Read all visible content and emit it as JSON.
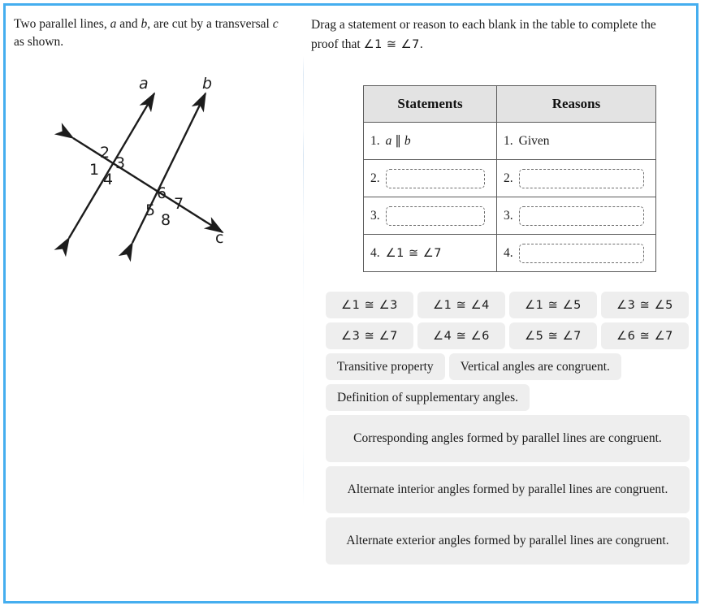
{
  "frame": {
    "border_color": "#45aeef",
    "background": "#ffffff"
  },
  "left": {
    "prompt_line1_a": "Two parallel lines, ",
    "prompt_line1_b": "a",
    "prompt_line1_c": " and ",
    "prompt_line1_d": "b",
    "prompt_line1_e": ", are cut by a transversal ",
    "prompt_line1_f": "c",
    "prompt_line1_g": " as shown.",
    "diagram": {
      "name": "two-parallel-lines-cut-by-transversal",
      "line_labels": [
        "a",
        "b",
        "c"
      ],
      "angle_labels": [
        "1",
        "2",
        "3",
        "4",
        "5",
        "6",
        "7",
        "8"
      ],
      "stroke_color": "#1c1c1c"
    }
  },
  "right": {
    "prompt_a": "Drag a statement or reason to each blank in the table to complete the proof that ",
    "prompt_angle": "∠1 ≅ ∠7",
    "prompt_b": "."
  },
  "table": {
    "headers": [
      "Statements",
      "Reasons"
    ],
    "rows": [
      {
        "statement_num": "1.",
        "statement_text": "a ∥ b",
        "statement_italic_a": "a",
        "statement_mid": " ∥ ",
        "statement_italic_b": "b",
        "statement_blank": false,
        "reason_num": "1.",
        "reason_text": "Given",
        "reason_blank": false
      },
      {
        "statement_num": "2.",
        "statement_text": "",
        "statement_blank": true,
        "reason_num": "2.",
        "reason_text": "",
        "reason_blank": true
      },
      {
        "statement_num": "3.",
        "statement_text": "",
        "statement_blank": true,
        "reason_num": "3.",
        "reason_text": "",
        "reason_blank": true
      },
      {
        "statement_num": "4.",
        "statement_text": "∠1 ≅ ∠7",
        "statement_blank": false,
        "reason_num": "4.",
        "reason_text": "",
        "reason_blank": true
      }
    ]
  },
  "tiles": {
    "background": "#eeeeee",
    "row1": [
      "∠1 ≅ ∠3",
      "∠1 ≅ ∠4",
      "∠1 ≅ ∠5",
      "∠3 ≅ ∠5"
    ],
    "row2": [
      "∠3 ≅ ∠7",
      "∠4 ≅ ∠6",
      "∠5 ≅ ∠7",
      "∠6 ≅ ∠7"
    ],
    "row3": [
      "Transitive property",
      "Vertical angles are congruent."
    ],
    "row4": [
      "Definition of supplementary angles."
    ],
    "wide": [
      "Corresponding angles formed by parallel lines are congruent.",
      "Alternate interior angles formed by parallel lines are congruent.",
      "Alternate exterior angles formed by parallel lines are congruent."
    ]
  }
}
